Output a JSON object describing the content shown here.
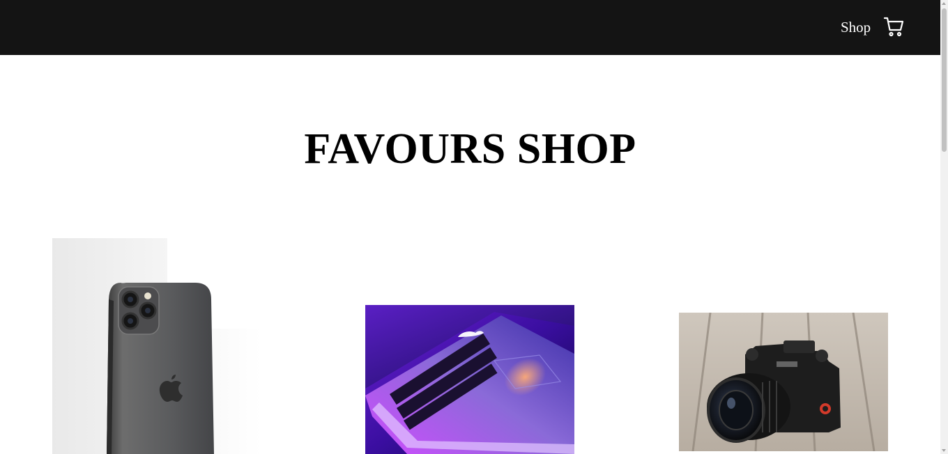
{
  "navbar": {
    "shop_link": "Shop",
    "cart_icon": "shopping-cart-icon",
    "background": "#141414"
  },
  "header": {
    "title": "FAVOURS SHOP"
  },
  "products": [
    {
      "image": "smartphone-photo"
    },
    {
      "image": "laptop-photo"
    },
    {
      "image": "camera-photo"
    }
  ]
}
